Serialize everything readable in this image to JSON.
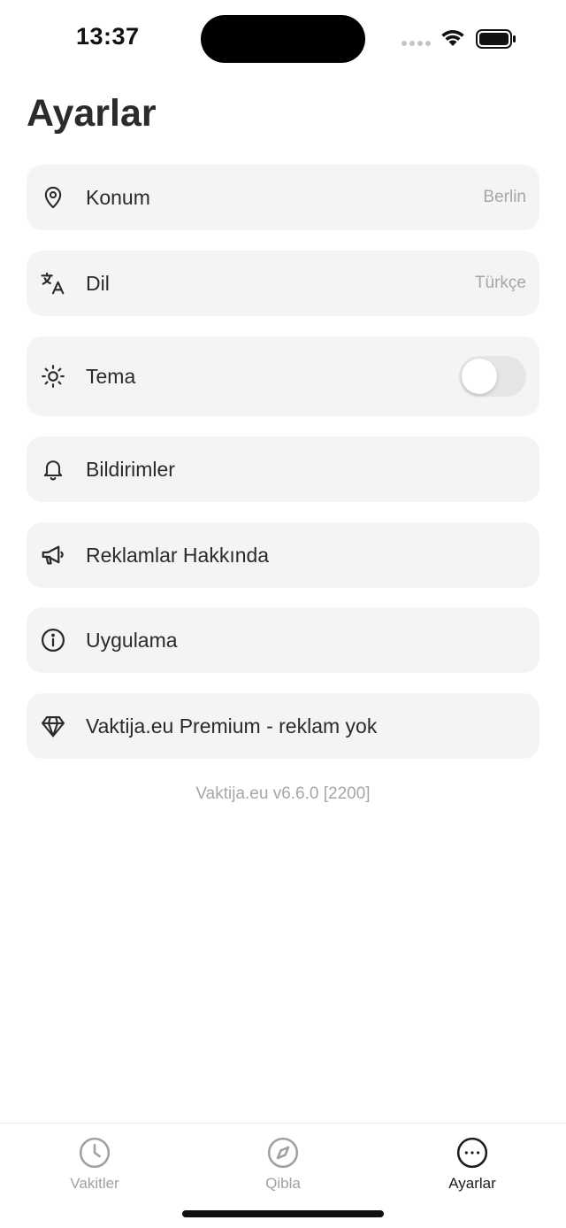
{
  "status_bar": {
    "time": "13:37"
  },
  "page": {
    "title": "Ayarlar"
  },
  "settings": [
    {
      "label": "Konum",
      "value": "Berlin",
      "icon": "location-pin-icon"
    },
    {
      "label": "Dil",
      "value": "Türkçe",
      "icon": "translate-icon"
    },
    {
      "label": "Tema",
      "toggle_on": false,
      "icon": "sun-icon"
    },
    {
      "label": "Bildirimler",
      "icon": "bell-icon"
    },
    {
      "label": "Reklamlar Hakkında",
      "icon": "megaphone-icon"
    },
    {
      "label": "Uygulama",
      "icon": "info-icon"
    },
    {
      "label": "Vaktija.eu Premium - reklam yok",
      "icon": "diamond-icon"
    }
  ],
  "version": "Vaktija.eu v6.6.0 [2200]",
  "tabs": [
    {
      "label": "Vakitler",
      "icon": "clock-icon",
      "active": false
    },
    {
      "label": "Qibla",
      "icon": "compass-icon",
      "active": false
    },
    {
      "label": "Ayarlar",
      "icon": "more-icon",
      "active": true
    }
  ],
  "colors": {
    "row_background": "#f4f4f4",
    "secondary_text": "#a6a6a6",
    "active_tab": "#1c1c1c",
    "inactive_tab": "#a0a0a0"
  }
}
